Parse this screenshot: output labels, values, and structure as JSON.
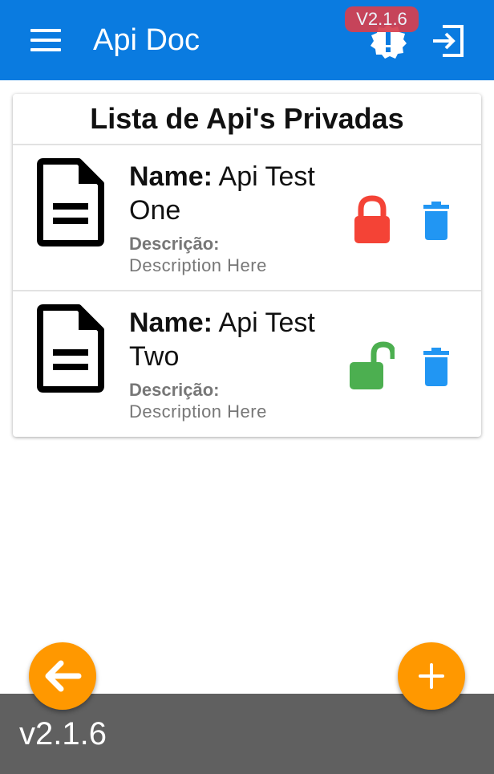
{
  "appbar": {
    "title": "Api Doc",
    "version_badge": "V2.1.6",
    "background_color": "#0a7be0",
    "icons": [
      "menu-icon",
      "alert-badge-icon",
      "logout-icon"
    ]
  },
  "card": {
    "title": "Lista de Api's Privadas",
    "items": [
      {
        "name_label": "Name:",
        "name_value": "Api Test One",
        "description_label": "Descrição:",
        "description_value": "Description Here",
        "locked": true,
        "lock_color": "#f44336",
        "icons": [
          "document-icon",
          "lock-closed-icon",
          "trash-icon"
        ]
      },
      {
        "name_label": "Name:",
        "name_value": "Api Test Two",
        "description_label": "Descrição:",
        "description_value": "Description Here",
        "locked": false,
        "lock_color": "#4caf50",
        "icons": [
          "document-icon",
          "lock-open-icon",
          "trash-icon"
        ]
      }
    ],
    "trash_color": "#2196f3"
  },
  "fabs": {
    "back_icon": "arrow-left-icon",
    "add_icon": "plus-icon",
    "color": "#ff9800"
  },
  "footer": {
    "version": "v2.1.6",
    "background_color": "#606060"
  }
}
